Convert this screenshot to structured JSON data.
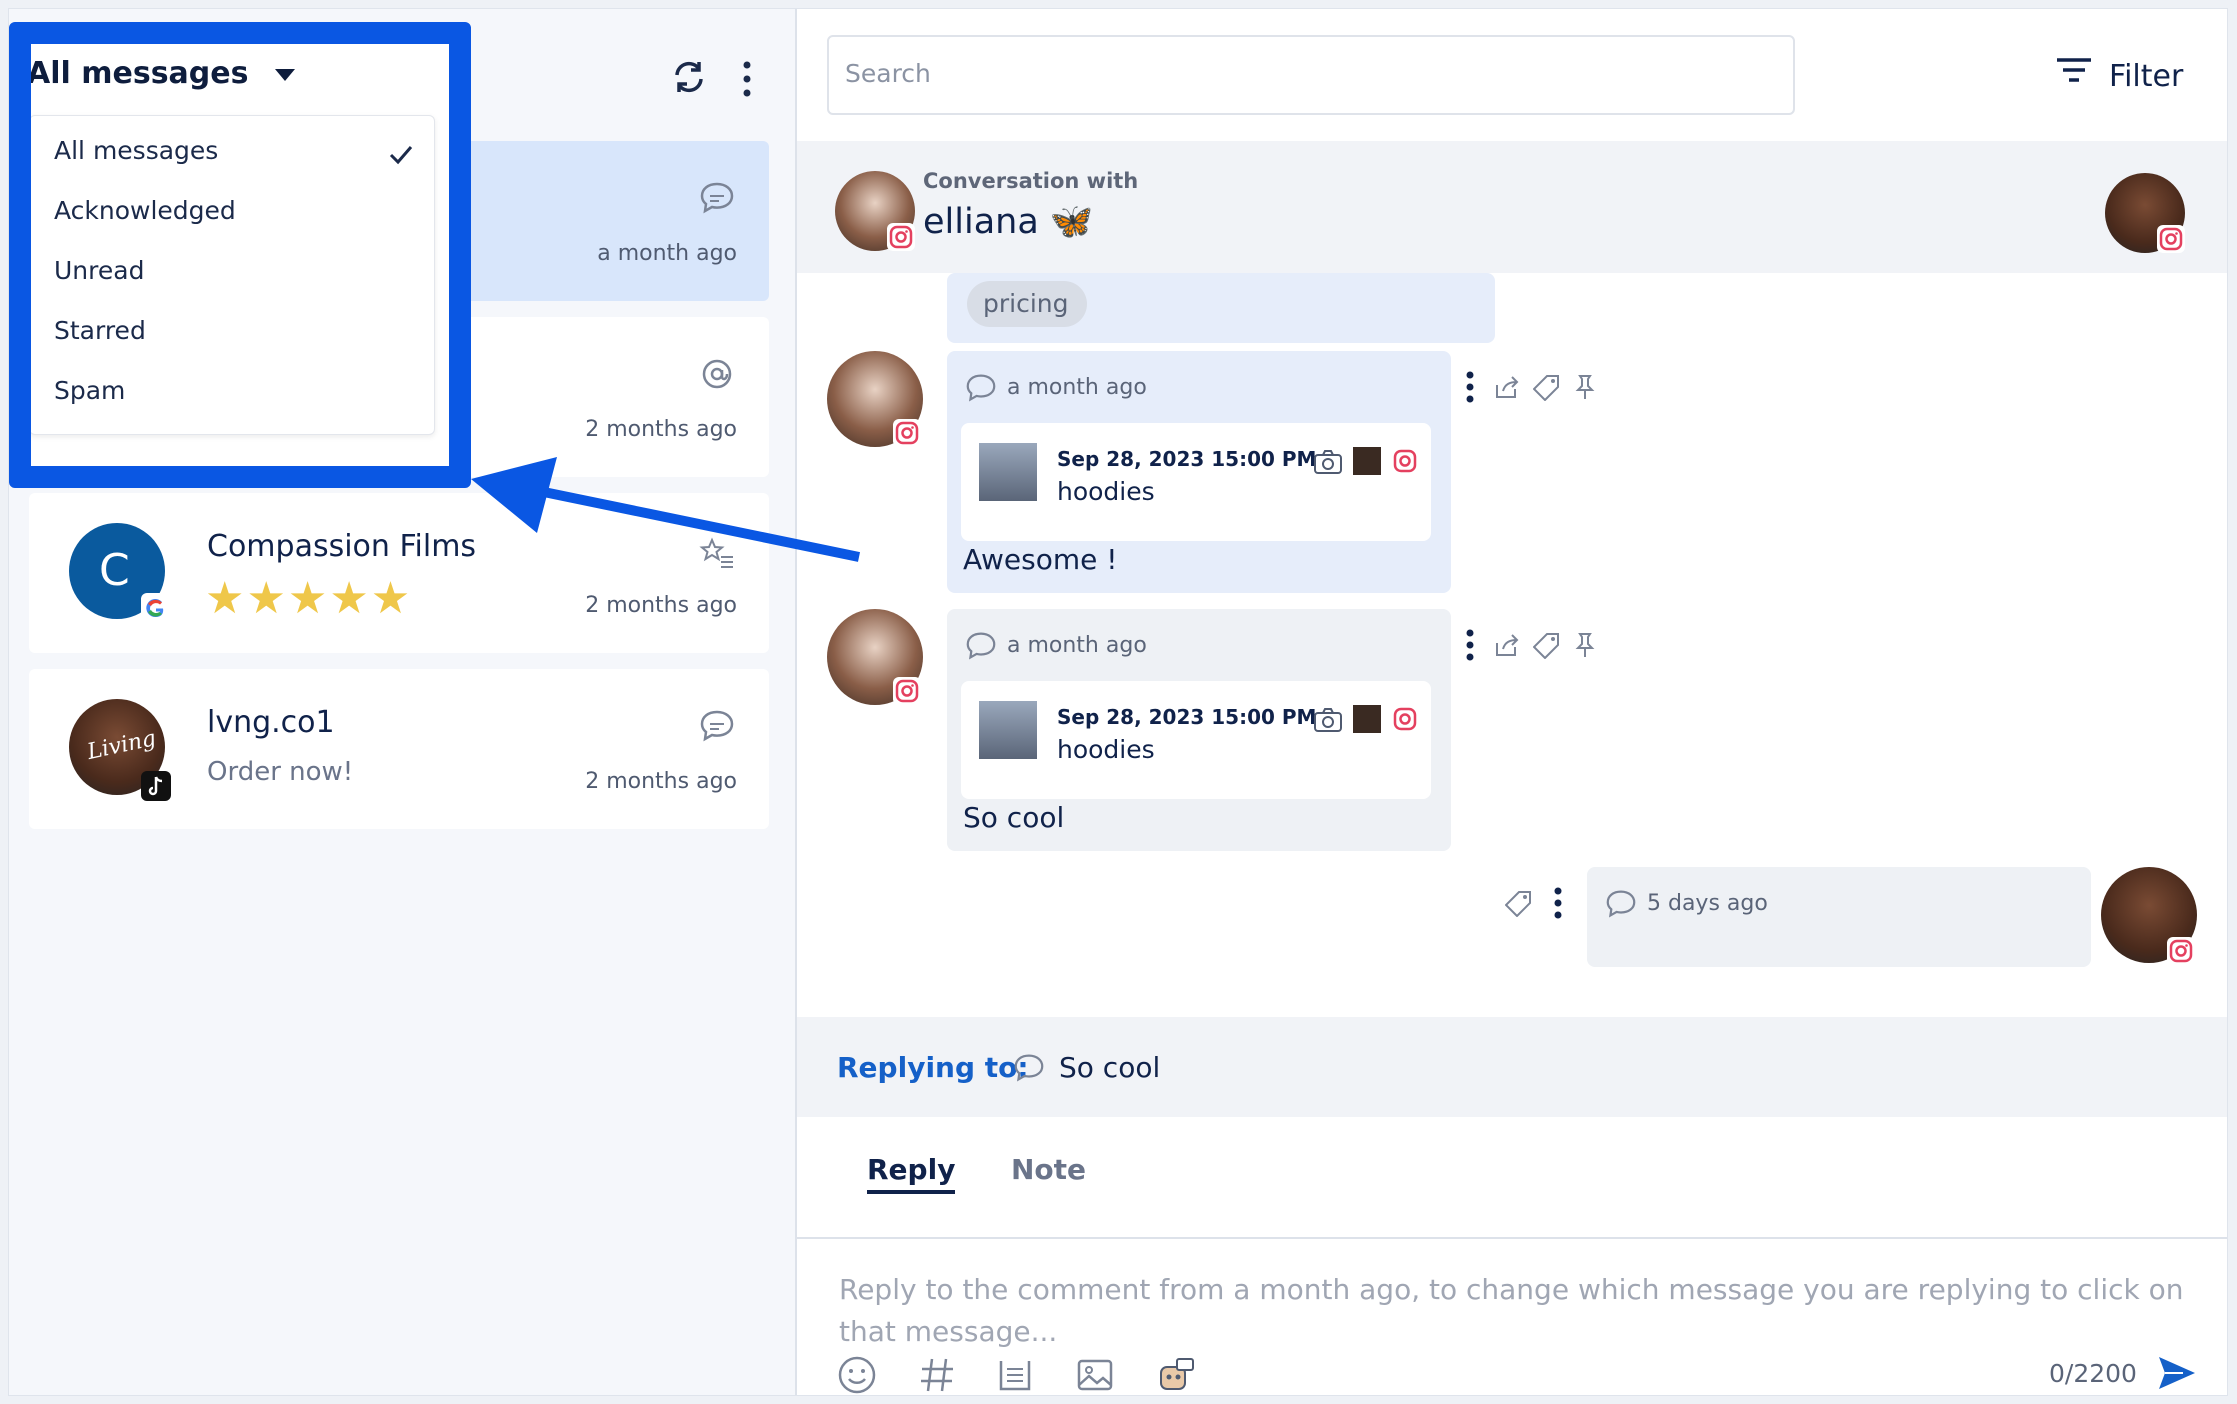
{
  "inbox": {
    "filter_label": "All messages",
    "menu_items": [
      "All messages",
      "Acknowledged",
      "Unread",
      "Starred",
      "Spam"
    ],
    "selected_item": "All messages",
    "conversations": [
      {
        "name": "",
        "subtitle": "",
        "time": "a month ago",
        "icon": "comment-icon",
        "platform": "instagram"
      },
      {
        "name": "",
        "subtitle": "",
        "time": "2 months ago",
        "icon": "mention-icon",
        "platform": "instagram"
      },
      {
        "name": "Compassion Films",
        "avatar_letter": "C",
        "rating": "★★★★★",
        "time": "2 months ago",
        "icon": "review-icon",
        "platform": "google"
      },
      {
        "name": "lvng.co1",
        "subtitle": "Order now!",
        "time": "2 months ago",
        "icon": "comment-icon",
        "platform": "tiktok"
      }
    ]
  },
  "search": {
    "placeholder": "Search"
  },
  "filter": {
    "label": "Filter"
  },
  "conversation": {
    "header_label": "Conversation with",
    "name": "elliana 🦋",
    "tag": "pricing",
    "messages": [
      {
        "time": "a month ago",
        "post_date": "Sep 28, 2023 15:00 PM",
        "post_title": "hoodies",
        "text": "Awesome !"
      },
      {
        "time": "a month ago",
        "post_date": "Sep 28, 2023 15:00 PM",
        "post_title": "hoodies",
        "text": "So cool"
      },
      {
        "time": "5 days ago"
      }
    ]
  },
  "reply": {
    "replying_to_label": "Replying to:",
    "replying_to_text": "So cool",
    "tabs": [
      "Reply",
      "Note"
    ],
    "active_tab": "Reply",
    "placeholder": "Reply to the comment from a month ago, to change which message you are replying to click on that message...",
    "char_count": "0/2200"
  },
  "colors": {
    "accent": "#1560c8",
    "highlight_box": "#0a57e3",
    "selected_row": "#d8e6fb",
    "stars": "#efc74a"
  }
}
